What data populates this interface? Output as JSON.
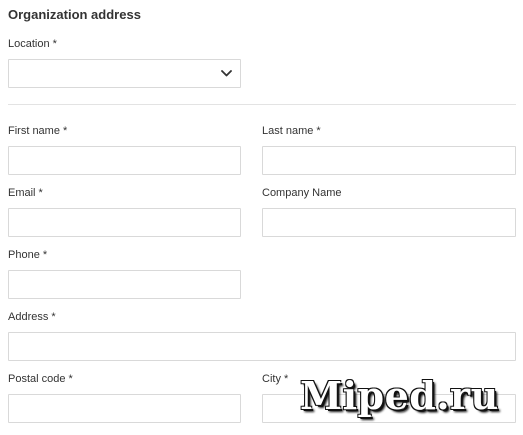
{
  "section": {
    "title": "Organization address"
  },
  "location": {
    "label": "Location *",
    "value": ""
  },
  "first_name": {
    "label": "First name *",
    "value": ""
  },
  "last_name": {
    "label": "Last name *",
    "value": ""
  },
  "email": {
    "label": "Email *",
    "value": ""
  },
  "company_name": {
    "label": "Company Name",
    "value": ""
  },
  "phone": {
    "label": "Phone *",
    "value": ""
  },
  "address": {
    "label": "Address *",
    "value": ""
  },
  "postal_code": {
    "label": "Postal code *",
    "value": ""
  },
  "city": {
    "label": "City *",
    "value": ""
  },
  "icons": {
    "location_dropdown": "chevron-down-icon"
  },
  "watermark": {
    "text": "Miped.ru"
  }
}
